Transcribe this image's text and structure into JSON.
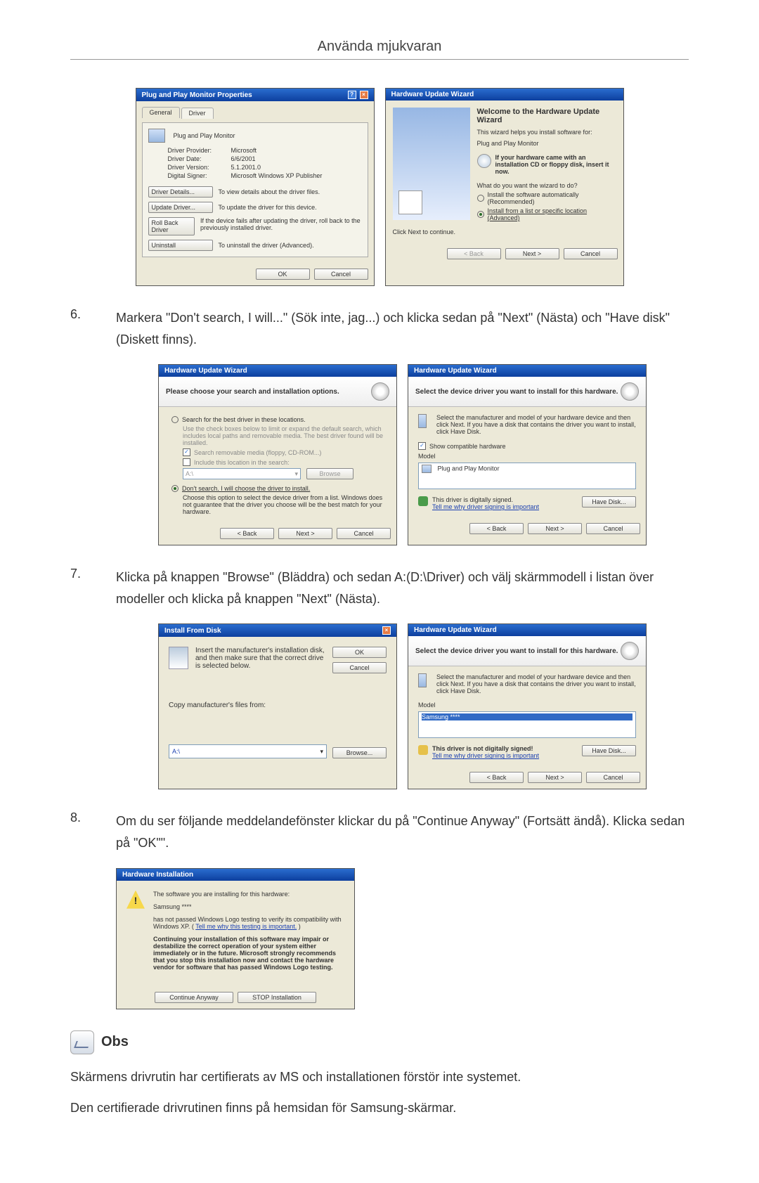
{
  "page_title": "Använda mjukvaran",
  "steps": {
    "s6": {
      "num": "6.",
      "text": "Markera \"Don't search, I will...\" (Sök inte, jag...) och klicka sedan på \"Next\" (Nästa) och \"Have disk\" (Diskett finns)."
    },
    "s7": {
      "num": "7.",
      "text": "Klicka på knappen \"Browse\" (Bläddra) och sedan A:(D:\\Driver) och välj skärmmodell i listan över modeller och klicka på knappen \"Next\" (Nästa)."
    },
    "s8": {
      "num": "8.",
      "text": "Om du ser följande meddelandefönster klickar du på \"Continue Anyway\" (Fortsätt ändå). Klicka sedan på \"OK\"\"."
    }
  },
  "note": {
    "label": "Obs",
    "line1": "Skärmens drivrutin har certifierats av MS och installationen förstör inte systemet.",
    "line2": "Den certifierade drivrutinen finns på hemsidan för Samsung-skärmar."
  },
  "win_props": {
    "title": "Plug and Play Monitor Properties",
    "tab_general": "General",
    "tab_driver": "Driver",
    "device_name": "Plug and Play Monitor",
    "rows": {
      "provider_label": "Driver Provider:",
      "provider_value": "Microsoft",
      "date_label": "Driver Date:",
      "date_value": "6/6/2001",
      "version_label": "Driver Version:",
      "version_value": "5.1.2001.0",
      "signer_label": "Digital Signer:",
      "signer_value": "Microsoft Windows XP Publisher"
    },
    "btn_details": "Driver Details...",
    "btn_details_desc": "To view details about the driver files.",
    "btn_update": "Update Driver...",
    "btn_update_desc": "To update the driver for this device.",
    "btn_rollback": "Roll Back Driver",
    "btn_rollback_desc": "If the device fails after updating the driver, roll back to the previously installed driver.",
    "btn_uninstall": "Uninstall",
    "btn_uninstall_desc": "To uninstall the driver (Advanced).",
    "ok": "OK",
    "cancel": "Cancel"
  },
  "win_wizard_welcome": {
    "title": "Hardware Update Wizard",
    "heading": "Welcome to the Hardware Update Wizard",
    "sub1": "This wizard helps you install software for:",
    "device": "Plug and Play Monitor",
    "cd_text": "If your hardware came with an installation CD or floppy disk, insert it now.",
    "question": "What do you want the wizard to do?",
    "opt1": "Install the software automatically (Recommended)",
    "opt2": "Install from a list or specific location (Advanced)",
    "continue": "Click Next to continue.",
    "back": "< Back",
    "next": "Next >",
    "cancel": "Cancel"
  },
  "win_wizard_search": {
    "title": "Hardware Update Wizard",
    "header": "Please choose your search and installation options.",
    "opt_search": "Search for the best driver in these locations.",
    "opt_search_desc": "Use the check boxes below to limit or expand the default search, which includes local paths and removable media. The best driver found will be installed.",
    "chk_removable": "Search removable media (floppy, CD-ROM...)",
    "chk_include": "Include this location in the search:",
    "combo_placeholder": "A:\\",
    "browse": "Browse",
    "opt_dont": "Don't search. I will choose the driver to install.",
    "opt_dont_desc": "Choose this option to select the device driver from a list. Windows does not guarantee that the driver you choose will be the best match for your hardware.",
    "back": "< Back",
    "next": "Next >",
    "cancel": "Cancel"
  },
  "win_wizard_select1": {
    "title": "Hardware Update Wizard",
    "header": "Select the device driver you want to install for this hardware.",
    "instruction": "Select the manufacturer and model of your hardware device and then click Next. If you have a disk that contains the driver you want to install, click Have Disk.",
    "show_compat": "Show compatible hardware",
    "model_label": "Model",
    "model_value": "Plug and Play Monitor",
    "signed": "This driver is digitally signed.",
    "tell_me": "Tell me why driver signing is important",
    "have_disk": "Have Disk...",
    "back": "< Back",
    "next": "Next >",
    "cancel": "Cancel"
  },
  "win_install_disk": {
    "title": "Install From Disk",
    "instruction": "Insert the manufacturer's installation disk, and then make sure that the correct drive is selected below.",
    "ok": "OK",
    "cancel": "Cancel",
    "copy_label": "Copy manufacturer's files from:",
    "path": "A:\\",
    "browse": "Browse..."
  },
  "win_wizard_select2": {
    "title": "Hardware Update Wizard",
    "header": "Select the device driver you want to install for this hardware.",
    "instruction": "Select the manufacturer and model of your hardware device and then click Next. If you have a disk that contains the driver you want to install, click Have Disk.",
    "model_label": "Model",
    "model_value": "Samsung ****",
    "not_signed": "This driver is not digitally signed!",
    "tell_me": "Tell me why driver signing is important",
    "have_disk": "Have Disk...",
    "back": "< Back",
    "next": "Next >",
    "cancel": "Cancel"
  },
  "win_hw_install": {
    "title": "Hardware Installation",
    "line1": "The software you are installing for this hardware:",
    "device": "Samsung ****",
    "line2a": "has not passed Windows Logo testing to verify its compatibility with Windows XP. (",
    "line2_link": "Tell me why this testing is important.",
    "line2b": ")",
    "strong": "Continuing your installation of this software may impair or destabilize the correct operation of your system either immediately or in the future. Microsoft strongly recommends that you stop this installation now and contact the hardware vendor for software that has passed Windows Logo testing.",
    "btn_continue": "Continue Anyway",
    "btn_stop": "STOP Installation"
  }
}
